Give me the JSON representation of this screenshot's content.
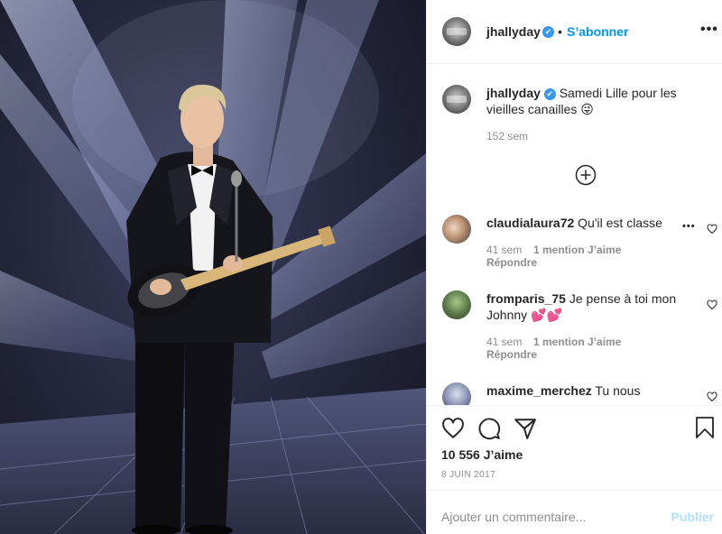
{
  "post": {
    "username": "jhallyday",
    "verified_badge": "✔",
    "separator": "•",
    "follow_label": "S’abonner",
    "more_label": "•••",
    "caption": "Samedi Lille pour les vieilles canailles 😜",
    "caption_time": "152 sem",
    "likes_text": "10 556 J’aime",
    "date": "8 JUIN 2017",
    "add_comment_placeholder": "Ajouter un commentaire...",
    "publish_label": "Publier",
    "load_more_icon": "plus-circle-icon"
  },
  "comments": [
    {
      "username": "claudialaura72",
      "text": "Qu'il est classe",
      "time": "41 sem",
      "likes": "1 mention J’aime",
      "reply": "Répondre",
      "more": "•••"
    },
    {
      "username": "fromparis_75",
      "text": "Je pense à toi mon Johnny 💕💕",
      "time": "41 sem",
      "likes": "1 mention J’aime",
      "reply": "Répondre"
    },
    {
      "username": "maxime_merchez",
      "text": "Tu nous"
    }
  ],
  "icons": {
    "like": "heart-icon",
    "comment": "comment-bubble-icon",
    "share": "paper-plane-icon",
    "save": "bookmark-icon"
  },
  "colors": {
    "accent": "#0095f6",
    "verified": "#3897f0",
    "muted": "#8e8e8e",
    "publish_disabled": "#b2dffc"
  }
}
